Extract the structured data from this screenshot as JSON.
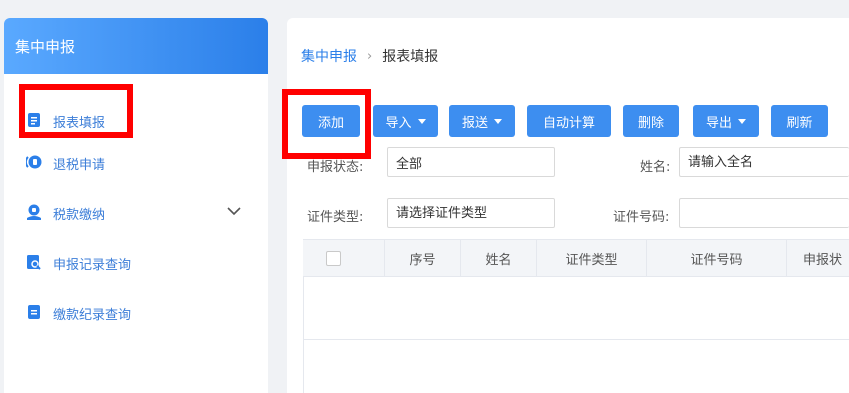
{
  "sidebar": {
    "title": "集中申报",
    "items": [
      {
        "label": "报表填报",
        "icon": "report-form-icon"
      },
      {
        "label": "退税申请",
        "icon": "tax-refund-icon"
      },
      {
        "label": "税款缴纳",
        "icon": "tax-payment-icon",
        "expandable": true
      },
      {
        "label": "申报记录查询",
        "icon": "search-record-icon"
      },
      {
        "label": "缴款纪录查询",
        "icon": "payment-record-icon"
      }
    ]
  },
  "breadcrumb": {
    "parent": "集中申报",
    "separator": "›",
    "current": "报表填报"
  },
  "toolbar": {
    "add": "添加",
    "import": "导入",
    "submit": "报送",
    "auto_calc": "自动计算",
    "delete": "删除",
    "export": "导出",
    "refresh": "刷新"
  },
  "filters": {
    "status_label": "申报状态:",
    "status_value": "全部",
    "name_label": "姓名:",
    "name_placeholder": "请输入全名",
    "id_type_label": "证件类型:",
    "id_type_placeholder": "请选择证件类型",
    "id_number_label": "证件号码:",
    "id_number_value": ""
  },
  "table": {
    "columns": [
      "序号",
      "姓名",
      "证件类型",
      "证件号码",
      "申报状"
    ]
  },
  "colors": {
    "accent": "#3d8ef0",
    "highlight": "#ff0000",
    "sidebar_header": "#2b7fe9"
  }
}
